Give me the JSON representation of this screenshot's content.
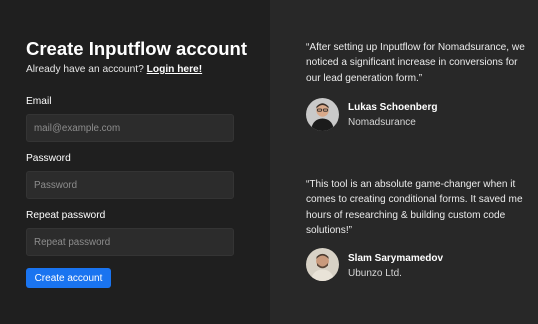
{
  "signup": {
    "title": "Create Inputflow account",
    "signin_prompt": "Already have an account?",
    "signin_link": "Login here!",
    "email_label": "Email",
    "email_placeholder": "mail@example.com",
    "password_label": "Password",
    "password_placeholder": "Password",
    "repeat_label": "Repeat password",
    "repeat_placeholder": "Repeat password",
    "submit_label": "Create account"
  },
  "testimonials": [
    {
      "quote": "“After setting up Inputflow for Nomadsurance, we noticed a significant increase in conversions for our lead generation form.”",
      "name": "Lukas Schoenberg",
      "company": "Nomadsurance"
    },
    {
      "quote": "“This tool is an absolute game-changer when it comes to creating conditional forms. It saved me hours of researching & building custom code solutions!”",
      "name": "Slam Sarymamedov",
      "company": "Ubunzo Ltd."
    }
  ],
  "colors": {
    "left_bg": "#1f1f1f",
    "right_bg": "#282828",
    "field_bg": "#2c2c2c",
    "accent": "#1a74f0"
  }
}
